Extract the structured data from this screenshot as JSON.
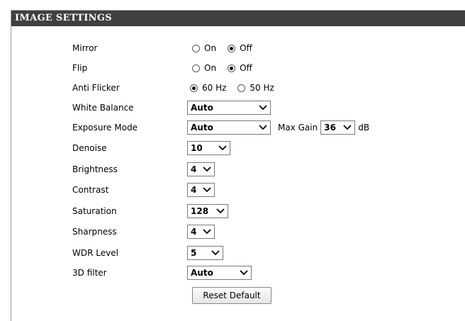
{
  "section": {
    "title": "IMAGE SETTINGS"
  },
  "settings": {
    "mirror": {
      "label": "Mirror",
      "options": [
        "On",
        "Off"
      ],
      "selected": "Off"
    },
    "flip": {
      "label": "Flip",
      "options": [
        "On",
        "Off"
      ],
      "selected": "Off"
    },
    "anti_flicker": {
      "label": "Anti Flicker",
      "options": [
        "60 Hz",
        "50 Hz"
      ],
      "selected": "60 Hz"
    },
    "white_balance": {
      "label": "White Balance",
      "value": "Auto"
    },
    "exposure_mode": {
      "label": "Exposure Mode",
      "value": "Auto",
      "max_gain_label": "Max Gain",
      "max_gain_value": "36",
      "max_gain_unit": "dB"
    },
    "denoise": {
      "label": "Denoise",
      "value": "10"
    },
    "brightness": {
      "label": "Brightness",
      "value": "4"
    },
    "contrast": {
      "label": "Contrast",
      "value": "4"
    },
    "saturation": {
      "label": "Saturation",
      "value": "128"
    },
    "sharpness": {
      "label": "Sharpness",
      "value": "4"
    },
    "wdr_level": {
      "label": "WDR Level",
      "value": "5"
    },
    "filter_3d": {
      "label": "3D filter",
      "value": "Auto"
    }
  },
  "actions": {
    "reset_label": "Reset Default"
  },
  "icons": {
    "chevron": "chevron-down-icon"
  },
  "colors": {
    "header_bg": "#404040",
    "header_text": "#ffffff"
  }
}
